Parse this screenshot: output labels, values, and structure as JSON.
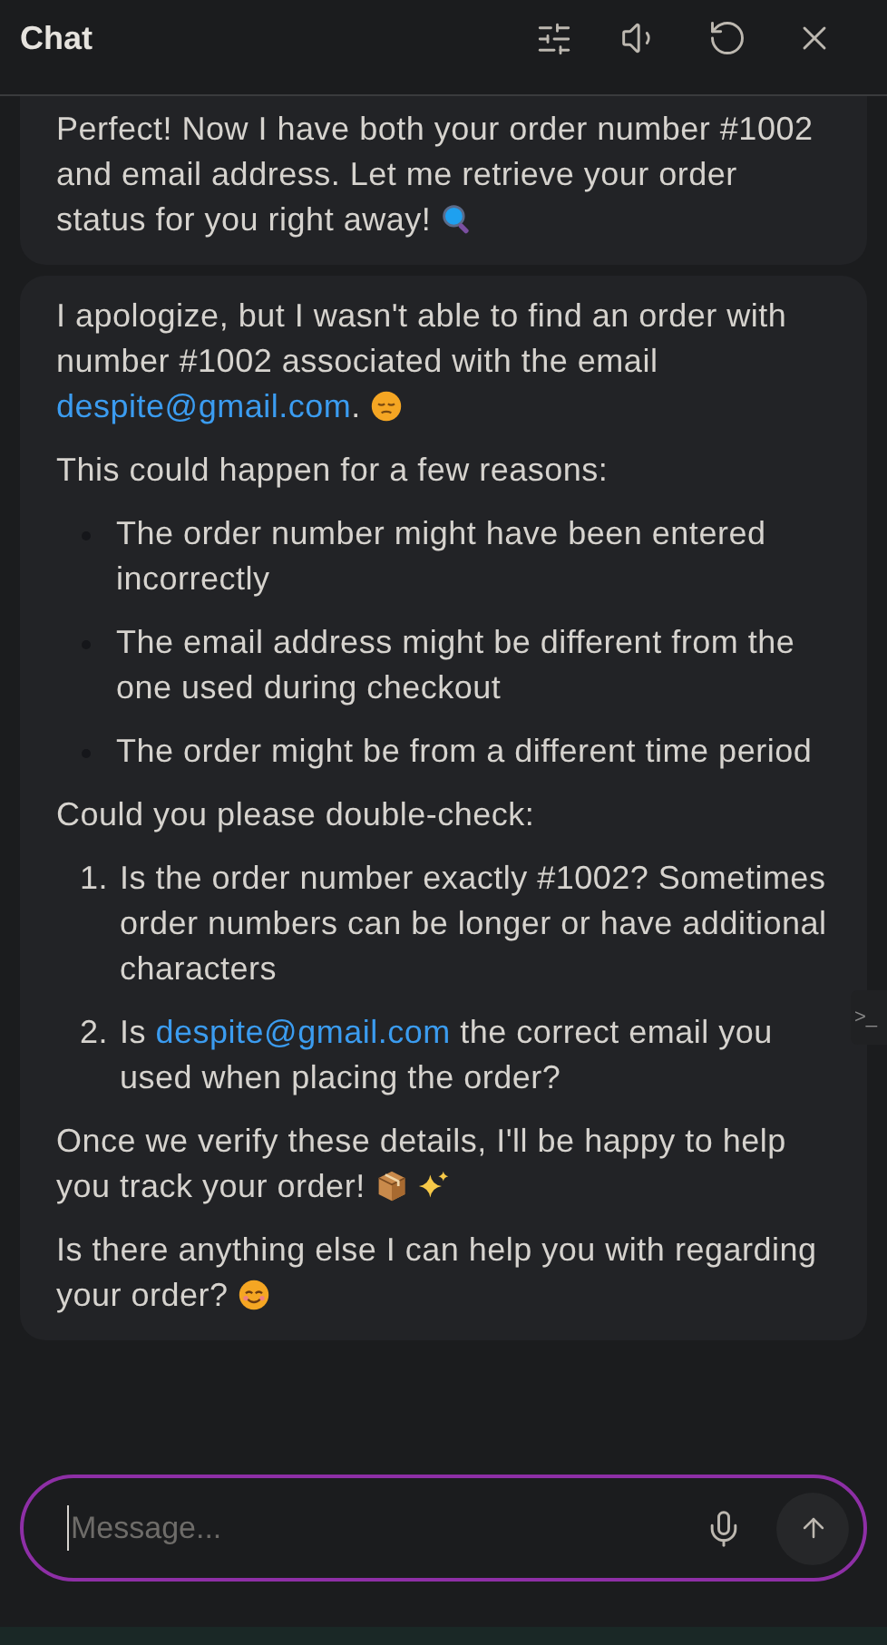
{
  "header": {
    "title": "Chat"
  },
  "messages": [
    {
      "cut_top": true,
      "blocks": [
        {
          "kind": "paragraph",
          "parts": [
            {
              "kind": "text",
              "text": "Perfect! Now I have both your order number #1002 and email address. Let me retrieve your order status for you right away! "
            },
            {
              "kind": "icon"
            }
          ]
        }
      ]
    },
    {
      "cut_top": false,
      "blocks": [
        {
          "kind": "paragraph",
          "parts": [
            {
              "kind": "text",
              "text": "I apologize, but I wasn't able to find an order with number #1002 associated with the email "
            },
            {
              "kind": "link",
              "text": "despite@gmail.com"
            },
            {
              "kind": "text",
              "text": ". "
            },
            {
              "kind": "icon"
            }
          ]
        },
        {
          "kind": "paragraph",
          "parts": [
            {
              "kind": "text",
              "text": "This could happen for a few reasons:"
            }
          ]
        },
        {
          "kind": "bullets",
          "items": [
            {
              "parts": [
                {
                  "kind": "text",
                  "text": "The order number might have been entered incorrectly"
                }
              ]
            },
            {
              "parts": [
                {
                  "kind": "text",
                  "text": "The email address might be different from the one used during checkout"
                }
              ]
            },
            {
              "parts": [
                {
                  "kind": "text",
                  "text": "The order might be from a different time period"
                }
              ]
            }
          ]
        },
        {
          "kind": "paragraph",
          "parts": [
            {
              "kind": "text",
              "text": "Could you please double-check:"
            }
          ]
        },
        {
          "kind": "numbered",
          "items": [
            {
              "number": "1.",
              "parts": [
                {
                  "kind": "text",
                  "text": "Is the order number exactly #1002? Sometimes order numbers can be longer or have additional characters"
                }
              ]
            },
            {
              "number": "2.",
              "parts": [
                {
                  "kind": "text",
                  "text": "Is "
                },
                {
                  "kind": "link",
                  "text": "despite@gmail.com"
                },
                {
                  "kind": "text",
                  "text": " the correct email you used when placing the order?"
                }
              ]
            }
          ]
        },
        {
          "kind": "paragraph",
          "parts": [
            {
              "kind": "text",
              "text": "Once we verify these details, I'll be happy to help you track your order! "
            },
            {
              "kind": "icon"
            },
            {
              "kind": "icon"
            }
          ]
        },
        {
          "kind": "paragraph",
          "parts": [
            {
              "kind": "text",
              "text": "Is there anything else I can help you with regarding your order? "
            },
            {
              "kind": "icon"
            }
          ]
        }
      ]
    }
  ],
  "side_tab": {
    "label": ">_"
  },
  "input": {
    "placeholder": "Message..."
  }
}
